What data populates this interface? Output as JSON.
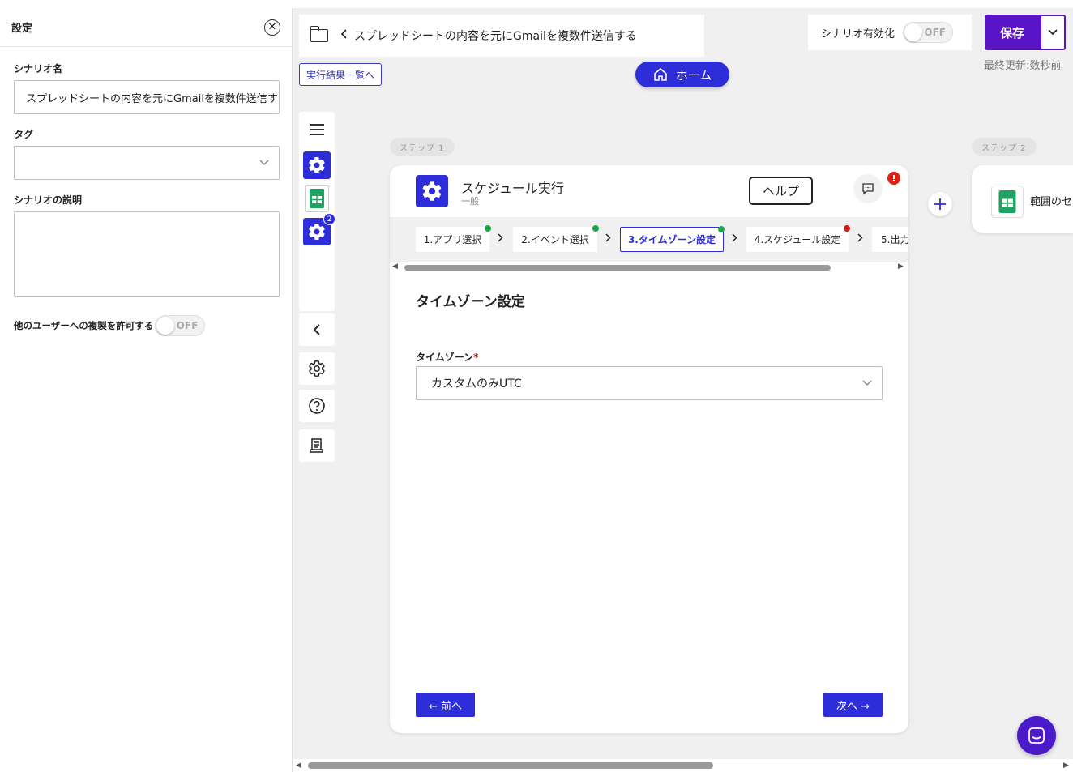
{
  "settings": {
    "title": "設定",
    "scenario_name_label": "シナリオ名",
    "scenario_name_value": "スプレッドシートの内容を元にGmailを複数件送信する",
    "tag_label": "タグ",
    "description_label": "シナリオの説明",
    "copy_permission_label": "他のユーザーへの複製を許可する",
    "copy_permission_state": "OFF"
  },
  "header": {
    "scenario_title": "スプレッドシートの内容を元にGmailを複数件送信する",
    "results_link": "実行結果一覧へ",
    "home_label": "ホーム",
    "enable_label": "シナリオ有効化",
    "enable_state": "OFF",
    "save_label": "保存",
    "last_updated": "最終更新:数秒前"
  },
  "toolbar": {
    "step_badge": "2"
  },
  "steps": {
    "step1_label": "ステップ 1",
    "step2_label": "ステップ 2"
  },
  "card": {
    "app_title": "スケジュール実行",
    "app_subtitle": "一般",
    "help_label": "ヘルプ",
    "alert_mark": "!",
    "tabs": [
      {
        "label": "1.アプリ選択",
        "status": "done"
      },
      {
        "label": "2.イベント選択",
        "status": "done"
      },
      {
        "label": "3.タイムゾーン設定",
        "status": "done"
      },
      {
        "label": "4.スケジュール設定",
        "status": "error"
      },
      {
        "label": "5.出力",
        "status": "none"
      }
    ],
    "section_title": "タイムゾーン設定",
    "timezone_label": "タイムゾーン",
    "required_mark": "*",
    "timezone_value": "カスタムのみUTC",
    "prev_label": "← 前へ",
    "next_label": "次へ →"
  },
  "card2": {
    "title": "範囲のセ"
  },
  "colors": {
    "accent": "#2d2dd9",
    "save": "#5a14c8",
    "done_dot": "#1ca84a",
    "error_dot": "#d21c1c"
  }
}
